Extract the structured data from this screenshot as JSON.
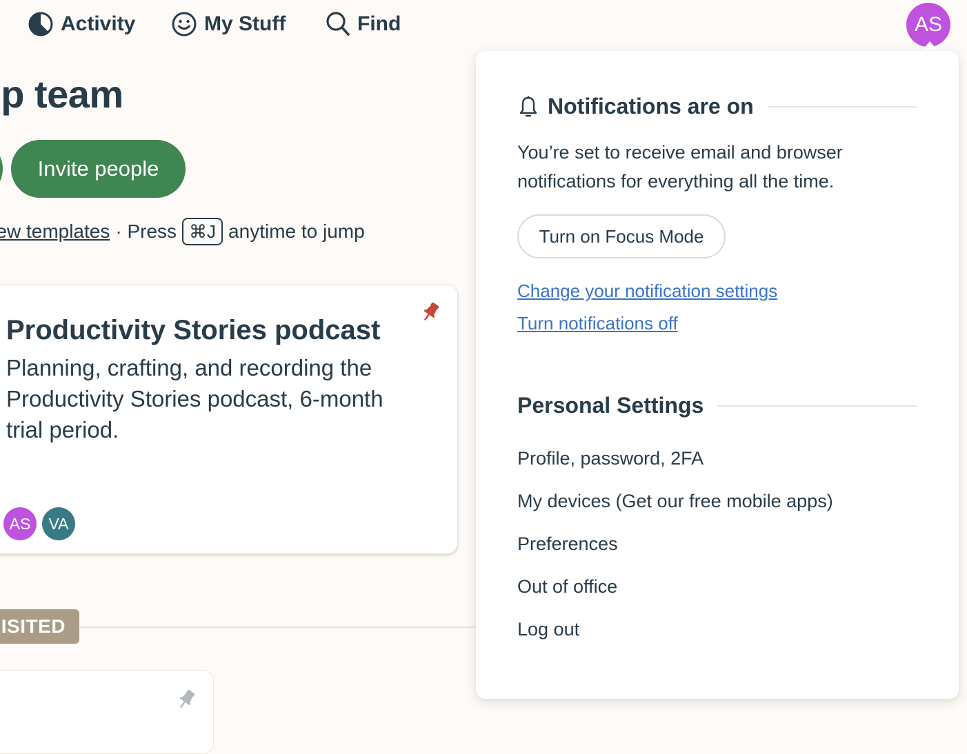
{
  "nav": {
    "items": [
      {
        "label": "Activity",
        "icon": "activity-pie-icon"
      },
      {
        "label": "My Stuff",
        "icon": "smiley-icon"
      },
      {
        "label": "Find",
        "icon": "search-icon"
      }
    ],
    "avatar_initials": "AS",
    "avatar_color": "#c052e0"
  },
  "main": {
    "title": "ecamp team",
    "invite_label": "Invite people",
    "hint": {
      "link": "View templates",
      "separator": "· Press",
      "shortcut": "⌘J",
      "suffix": "anytime to jump"
    },
    "project_card": {
      "title": "Productivity Stories podcast",
      "description": "Planning, crafting, and recording the Productivity Stories podcast, 6-month trial period.",
      "pinned": true,
      "pin_color": "#c5483a",
      "members": [
        {
          "initials": "AS",
          "color": "#c052e0"
        },
        {
          "initials": "VA",
          "color": "#3a7a86"
        }
      ]
    },
    "visited_label": "ISITED",
    "second_card": {
      "pinned": false,
      "pin_color": "#b3b8bd"
    }
  },
  "popover": {
    "notifications": {
      "heading": "Notifications are on",
      "text": "You’re set to receive email and browser notifications for everything all the time.",
      "focus_button": "Turn on Focus Mode",
      "links": [
        "Change your notification settings",
        "Turn notifications off"
      ]
    },
    "personal": {
      "heading": "Personal Settings",
      "items": [
        "Profile, password, 2FA",
        "My devices (Get our free mobile apps)",
        "Preferences",
        "Out of office",
        "Log out"
      ]
    }
  }
}
